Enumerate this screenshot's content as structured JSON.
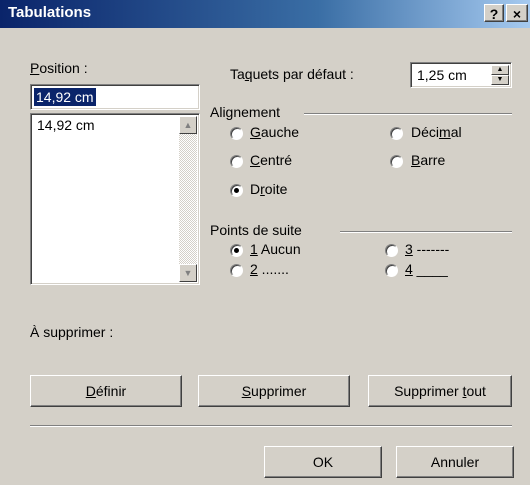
{
  "window": {
    "title": "Tabulations",
    "help_glyph": "?",
    "close_glyph": "×"
  },
  "position": {
    "label": "Position :",
    "label_mnemonic": "P",
    "label_rest": "osition :",
    "input_value": "14,92 cm",
    "list_items": [
      "14,92 cm"
    ]
  },
  "default_tabs": {
    "label_pre": "Ta",
    "label_mnemonic": "q",
    "label_post": "uets par défaut :",
    "value": "1,25 cm"
  },
  "alignment": {
    "group_label": "Alignement",
    "options": [
      {
        "pre": "",
        "mnemonic": "G",
        "post": "auche",
        "checked": false
      },
      {
        "pre": "",
        "mnemonic": "C",
        "post": "entré",
        "checked": false
      },
      {
        "pre": "D",
        "mnemonic": "r",
        "post": "oite",
        "checked": true
      },
      {
        "pre": "Déci",
        "mnemonic": "m",
        "post": "al",
        "checked": false
      },
      {
        "pre": "",
        "mnemonic": "B",
        "post": "arre",
        "checked": false
      }
    ]
  },
  "leaders": {
    "group_label": "Points de suite",
    "options": [
      {
        "mnemonic": "1",
        "post": " Aucun",
        "checked": true
      },
      {
        "mnemonic": "2",
        "post": " .......",
        "checked": false
      },
      {
        "mnemonic": "3",
        "post": " -------",
        "checked": false
      },
      {
        "mnemonic": "4",
        "post": " ____",
        "checked": false
      }
    ]
  },
  "to_delete": {
    "label": "À supprimer :"
  },
  "buttons": {
    "set": {
      "mnemonic": "D",
      "rest": "éfinir"
    },
    "clear": {
      "mnemonic": "S",
      "rest": "upprimer"
    },
    "clear_all": {
      "pre": "Supprimer ",
      "mnemonic": "t",
      "post": "out"
    },
    "ok": "OK",
    "cancel": "Annuler"
  }
}
